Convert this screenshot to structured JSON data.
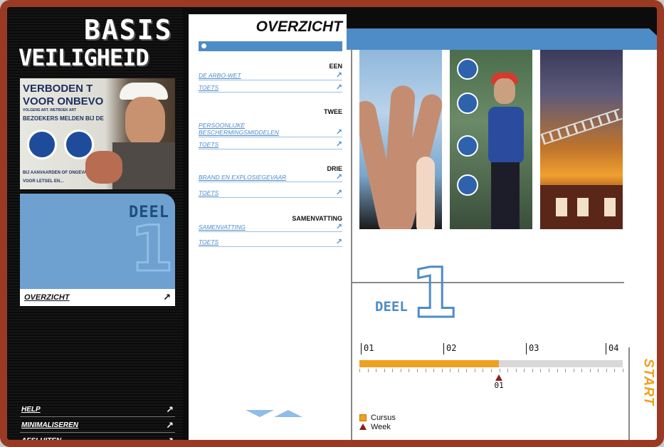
{
  "app": {
    "logo_line1": "BASIS",
    "logo_line2": "VEILIGHEID"
  },
  "sidebar": {
    "photo_sign_lines": [
      "VERBODEN T",
      "VOOR ONBEVO",
      "VOLGENS ART. WETBOEK ART",
      "BEZOEKERS MELDEN BIJ DE",
      "BIJ AANVAARDEN OF ONGEVAL",
      "VOOR LETSEL EN..."
    ],
    "deel_word": "DEEL",
    "deel_number": "1",
    "overzicht_label": "OVERZICHT",
    "bottom_links": [
      {
        "label": "HELP"
      },
      {
        "label": "MINIMALISEREN"
      },
      {
        "label": "AFSLUITEN"
      }
    ]
  },
  "main": {
    "title": "OVERZICHT",
    "sections": [
      {
        "title": "EEN",
        "items": [
          {
            "label": "DE ARBO-WET"
          },
          {
            "label": "TOETS"
          }
        ]
      },
      {
        "title": "TWEE",
        "items": [
          {
            "label": "PERSOONLIJKE BESCHERMINGSMIDDELEN"
          },
          {
            "label": "TOETS"
          }
        ]
      },
      {
        "title": "DRIE",
        "items": [
          {
            "label": "BRAND EN EXPLOSIEGEVAAR"
          },
          {
            "label": "TOETS"
          }
        ]
      },
      {
        "title": "SAMENVATTING",
        "items": [
          {
            "label": "SAMENVATTING"
          },
          {
            "label": "TOETS"
          }
        ]
      }
    ],
    "deel_word": "DEEL",
    "deel_number": "1",
    "timeline": {
      "labels": [
        "01",
        "02",
        "03",
        "04"
      ],
      "course_progress": 0.53,
      "week_marker_label": "01",
      "week_marker_position": 0.53
    },
    "legend": {
      "course": "Cursus",
      "week": "Week"
    },
    "start_label": "START"
  },
  "colors": {
    "accent_blue": "#4e8cc8",
    "light_blue": "#6ea0d0",
    "orange": "#f0a020",
    "frame_red": "#9a3a25",
    "marker_red": "#8b1e1e"
  }
}
